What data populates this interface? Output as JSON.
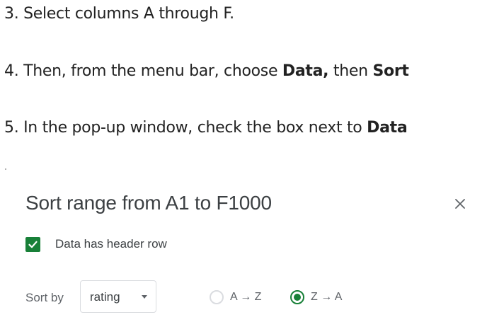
{
  "instructions": {
    "step3": {
      "text": "3. Select columns A through F."
    },
    "step4": {
      "text_before": "4. Then, from the menu bar, choose ",
      "bold1": "Data,",
      "text_middle": " then ",
      "bold2": "Sort"
    },
    "step5": {
      "text_before": "5. In the pop-up window, check the box next to ",
      "bold1": "Data"
    }
  },
  "dialog": {
    "title": "Sort range from A1 to F1000",
    "close_icon": "close-icon",
    "header_checkbox": {
      "label": "Data has header row",
      "checked": true
    },
    "sort_by": {
      "label": "Sort by",
      "selected_column": "rating",
      "options": [
        {
          "label": "A → Z",
          "selected": false
        },
        {
          "label": "Z → A",
          "selected": true
        }
      ]
    }
  },
  "colors": {
    "accent_green": "#188038",
    "text_dark": "#3c4043",
    "text_muted": "#5f6368",
    "border": "#dadce0"
  }
}
